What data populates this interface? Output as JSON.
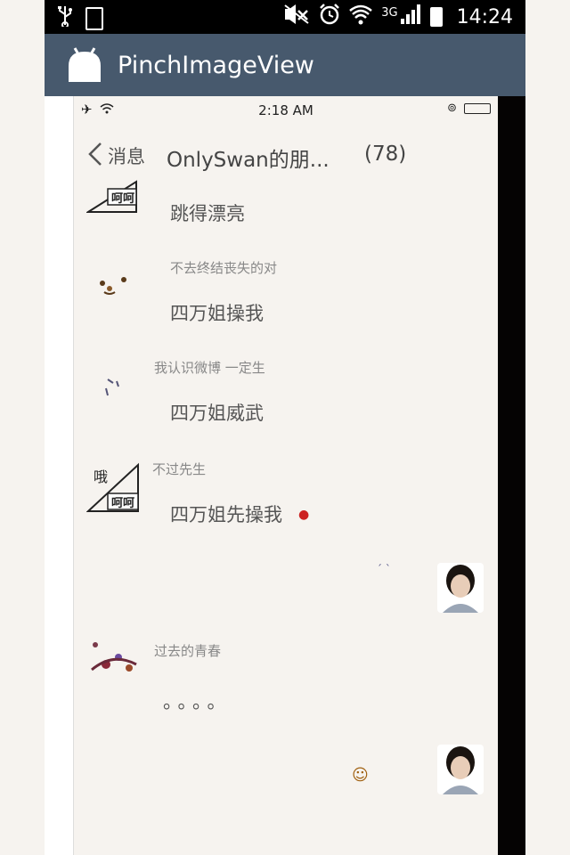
{
  "android_status": {
    "time": "14:24",
    "network": "3G",
    "icons": [
      "usb-icon",
      "battery-small-icon",
      "mute-icon",
      "alarm-icon",
      "wifi-icon",
      "signal-icon",
      "battery-icon"
    ]
  },
  "app_bar": {
    "title": "PinchImageView",
    "icon": "android-robot-icon",
    "color": "#47596d"
  },
  "ios_status": {
    "time": "2:18 AM",
    "icons": [
      "airplane-icon",
      "wifi-icon",
      "rotation-lock-icon",
      "battery-icon"
    ]
  },
  "nav": {
    "back_label": "消息",
    "title": "OnlySwan的朋...",
    "count": "(78)"
  },
  "messages": [
    {
      "sender": "",
      "text": "跳得漂亮",
      "avatar_text": "呵呵"
    },
    {
      "sender": "不去终结丧失的对",
      "text": "四万姐操我"
    },
    {
      "sender": "我认识微博 一定生",
      "text": "四万姐威武"
    },
    {
      "sender": "不过先生",
      "text": "四万姐先操我",
      "avatar_text_top": "哦",
      "avatar_text": "呵呵"
    },
    {
      "sender": "",
      "text": ""
    },
    {
      "sender": "过去的青春",
      "text": "。。。。"
    },
    {
      "sender": "",
      "text": ""
    }
  ]
}
